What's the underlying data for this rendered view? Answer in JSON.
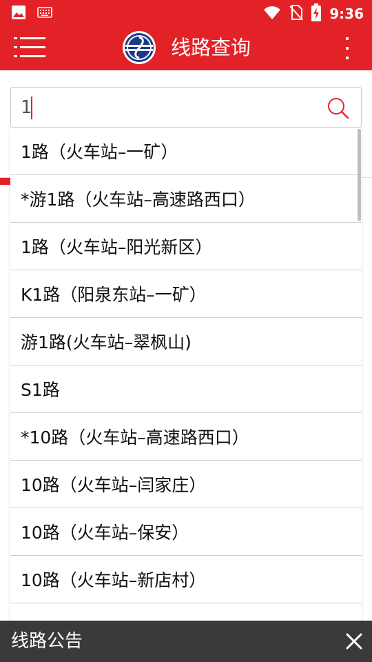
{
  "status_bar": {
    "time": "9:36",
    "left_icons": [
      "image-icon",
      "keyboard-icon"
    ],
    "right_icons": [
      "wifi-icon",
      "no-sim-icon",
      "battery-charging-icon"
    ]
  },
  "app_bar": {
    "title": "线路查询",
    "left_icon": "menu-icon",
    "right_icon": "more-vertical-icon",
    "logo_icon": "transit-logo-icon"
  },
  "search": {
    "value": "1",
    "icon": "search-icon"
  },
  "suggestions": [
    "1路（火车站–一矿）",
    "*游1路（火车站–高速路西口）",
    "1路（火车站–阳光新区）",
    "K1路（阳泉东站–一矿）",
    "游1路(火车站–翠枫山)",
    "S1路",
    "*10路（火车站–高速路西口）",
    "10路（火车站–闫家庄）",
    "10路（火车站–保安）",
    "10路（火车站–新店村）"
  ],
  "bottom_bar": {
    "label": "线路公告",
    "close_icon": "close-icon"
  },
  "colors": {
    "primary": "#e32227",
    "bottom_bar": "#3a3a3a",
    "divider": "#cfcfcf",
    "logo_blue": "#1b3a8c"
  }
}
